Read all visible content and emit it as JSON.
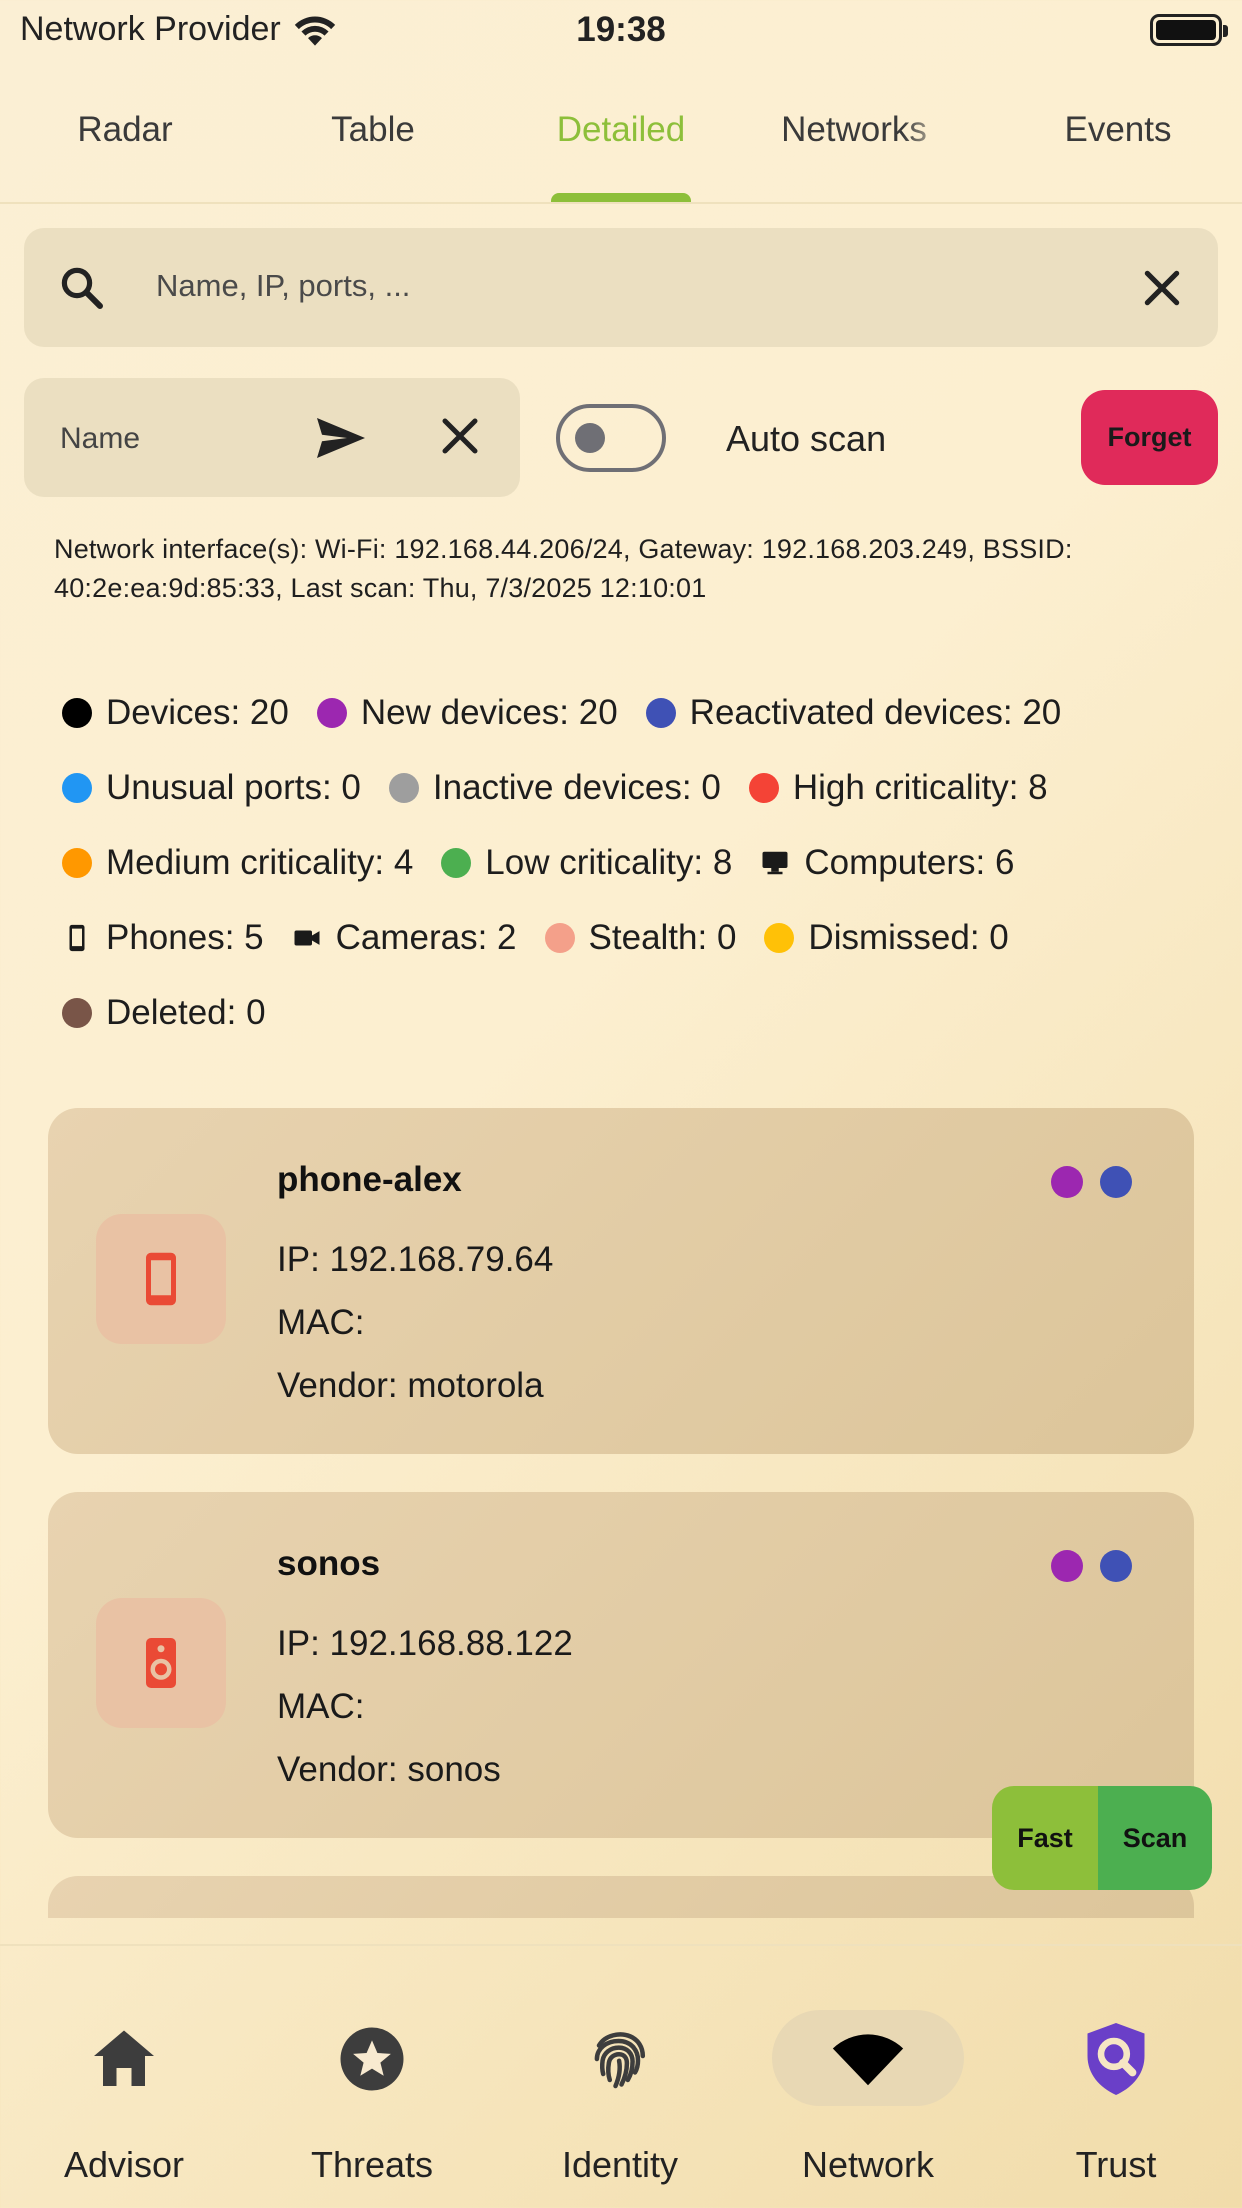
{
  "status_bar": {
    "carrier": "Network Provider",
    "time": "19:38"
  },
  "tabs": [
    {
      "label": "Radar"
    },
    {
      "label": "Table"
    },
    {
      "label": "Detailed",
      "active": true
    },
    {
      "label": "Networks"
    },
    {
      "label": "Events"
    }
  ],
  "search": {
    "placeholder": "Name, IP, ports, ..."
  },
  "name_filter": {
    "label": "Name"
  },
  "auto_scan": {
    "label": "Auto scan",
    "enabled": false
  },
  "forget_button": {
    "label": "Forget"
  },
  "info": "Network interface(s): Wi-Fi: 192.168.44.206/24, Gateway: 192.168.203.249, BSSID: 40:2e:ea:9d:85:33, Last scan: Thu, 7/3/2025 12:10:01",
  "legend": [
    {
      "label": "Devices: 20",
      "color": "#000000",
      "icon": "dot"
    },
    {
      "label": "New devices: 20",
      "color": "#9c27b0",
      "icon": "dot"
    },
    {
      "label": "Reactivated devices: 20",
      "color": "#3f51b5",
      "icon": "dot"
    },
    {
      "label": "Unusual ports: 0",
      "color": "#2196f3",
      "icon": "dot"
    },
    {
      "label": "Inactive devices: 0",
      "color": "#9e9e9e",
      "icon": "dot"
    },
    {
      "label": "High criticality: 8",
      "color": "#f44336",
      "icon": "dot"
    },
    {
      "label": "Medium criticality: 4",
      "color": "#ff9800",
      "icon": "dot"
    },
    {
      "label": "Low criticality: 8",
      "color": "#4caf50",
      "icon": "dot"
    },
    {
      "label": "Computers: 6",
      "color": "#1a1a1a",
      "icon": "computer-icon"
    },
    {
      "label": "Phones: 5",
      "color": "#1a1a1a",
      "icon": "phone-icon"
    },
    {
      "label": "Cameras: 2",
      "color": "#1a1a1a",
      "icon": "camera-icon"
    },
    {
      "label": "Stealth: 0",
      "color": "#f4a08a",
      "icon": "dot"
    },
    {
      "label": "Dismissed: 0",
      "color": "#ffc107",
      "icon": "dot"
    },
    {
      "label": "Deleted: 0",
      "color": "#795548",
      "icon": "dot"
    }
  ],
  "devices": [
    {
      "name": "phone-alex",
      "ip": "IP: 192.168.79.64",
      "mac": "MAC:",
      "vendor": "Vendor: motorola",
      "icon": "smartphone-icon",
      "status_colors": [
        "#9c27b0",
        "#3f51b5"
      ]
    },
    {
      "name": "sonos",
      "ip": "IP: 192.168.88.122",
      "mac": "MAC:",
      "vendor": "Vendor: sonos",
      "icon": "speaker-icon",
      "status_colors": [
        "#9c27b0",
        "#3f51b5"
      ]
    }
  ],
  "scan_buttons": {
    "fast": "Fast",
    "scan": "Scan"
  },
  "bottom_nav": [
    {
      "label": "Advisor",
      "icon": "home-icon"
    },
    {
      "label": "Threats",
      "icon": "star-badge-icon"
    },
    {
      "label": "Identity",
      "icon": "fingerprint-icon"
    },
    {
      "label": "Network",
      "icon": "wifi-icon",
      "active": true
    },
    {
      "label": "Trust",
      "icon": "shield-search-icon"
    }
  ],
  "colors": {
    "accent": "#8dbf3a",
    "forget": "#e02a5a",
    "scan": "#4caf50",
    "trust": "#6a3fc8"
  }
}
